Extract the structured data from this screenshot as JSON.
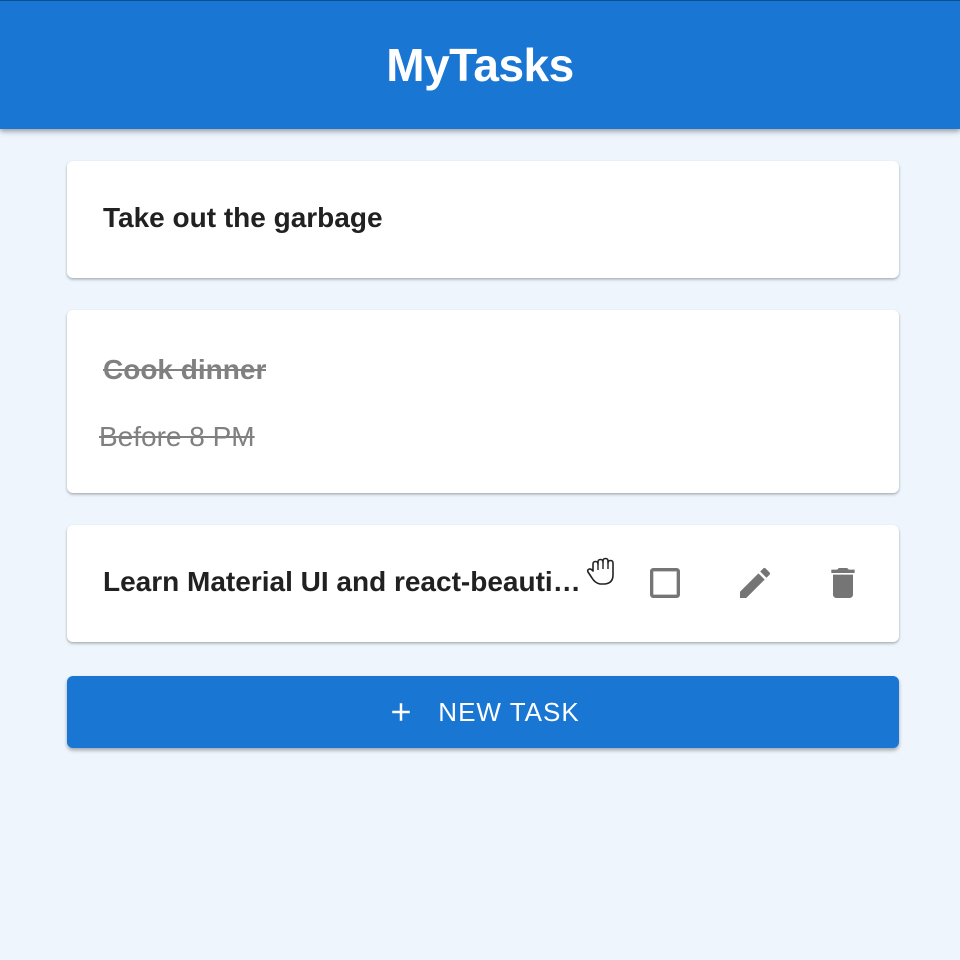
{
  "app": {
    "title": "MyTasks"
  },
  "tasks": [
    {
      "title": "Take out the garbage",
      "description": "",
      "completed": false
    },
    {
      "title": "Cook dinner",
      "description": "Before 8 PM",
      "completed": true
    },
    {
      "title": "Learn Material UI and react-beautiful-dnd",
      "description": "",
      "completed": false,
      "hovered": true
    }
  ],
  "task_actions": {
    "complete_icon": "checkbox-outline-icon",
    "edit_icon": "pencil-icon",
    "delete_icon": "trash-icon",
    "drag_icon": "grab-hand-icon"
  },
  "new_task": {
    "label": "NEW TASK",
    "icon": "plus-icon"
  },
  "colors": {
    "primary": "#1976d2",
    "background": "#eef5fd",
    "card": "#ffffff",
    "text": "#212121",
    "muted": "#808080",
    "icon": "#757575"
  }
}
